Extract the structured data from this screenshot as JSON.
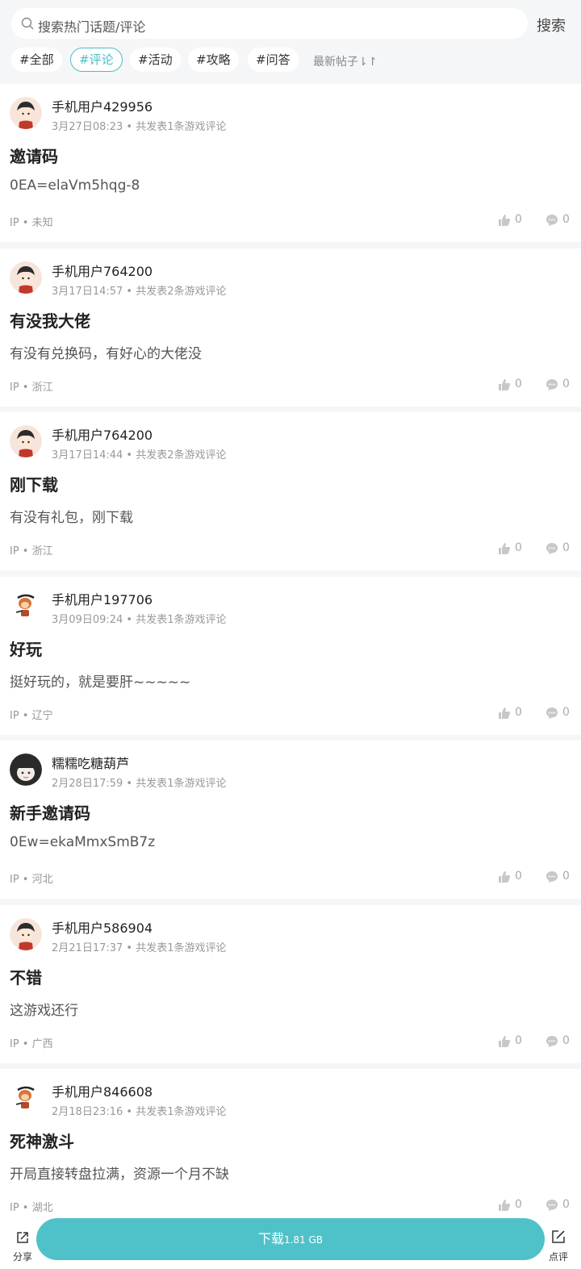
{
  "search": {
    "placeholder": "搜索热门话题/评论",
    "button": "搜索"
  },
  "tabs": [
    "#全部",
    "#评论",
    "#活动",
    "#攻略",
    "#问答"
  ],
  "sort_label": "最新帖子⇂↾",
  "posts": [
    {
      "user": "手机用户429956",
      "meta": "3月27日08:23 • 共发表1条游戏评论",
      "title": "邀请码",
      "body": "0EA=elaVm5hqg-8",
      "ip": "IP • 未知",
      "likes": "0",
      "comments": "0",
      "avatar": "boy"
    },
    {
      "user": "手机用户764200",
      "meta": "3月17日14:57 • 共发表2条游戏评论",
      "title": "有没我大佬",
      "body": "有没有兑换码，有好心的大佬没",
      "ip": "IP • 浙江",
      "likes": "0",
      "comments": "0",
      "avatar": "boy"
    },
    {
      "user": "手机用户764200",
      "meta": "3月17日14:44 • 共发表2条游戏评论",
      "title": "刚下载",
      "body": "有没有礼包，刚下载",
      "ip": "IP • 浙江",
      "likes": "0",
      "comments": "0",
      "avatar": "boy"
    },
    {
      "user": "手机用户197706",
      "meta": "3月09日09:24 • 共发表1条游戏评论",
      "title": "好玩",
      "body": "挺好玩的，就是要肝~~~~~",
      "ip": "IP • 辽宁",
      "likes": "0",
      "comments": "0",
      "avatar": "monkey"
    },
    {
      "user": "糯糯吃糖葫芦",
      "meta": "2月28日17:59 • 共发表1条游戏评论",
      "title": "新手邀请码",
      "body": "0Ew=ekaMmxSmB7z",
      "ip": "IP • 河北",
      "likes": "0",
      "comments": "0",
      "avatar": "girl"
    },
    {
      "user": "手机用户586904",
      "meta": "2月21日17:37 • 共发表1条游戏评论",
      "title": "不错",
      "body": "这游戏还行",
      "ip": "IP • 广西",
      "likes": "0",
      "comments": "0",
      "avatar": "boy"
    },
    {
      "user": "手机用户846608",
      "meta": "2月18日23:16 • 共发表1条游戏评论",
      "title": "死神激斗",
      "body": "开局直接转盘拉满，资源一个月不缺",
      "ip": "IP • 湖北",
      "likes": "0",
      "comments": "0",
      "avatar": "monkey"
    }
  ],
  "bottom": {
    "share": "分享",
    "download": "下载",
    "download_size": "1.81 GB",
    "review": "点评"
  },
  "colors": {
    "accent": "#4dbdc6",
    "download_bg": "#4fc1c9"
  }
}
